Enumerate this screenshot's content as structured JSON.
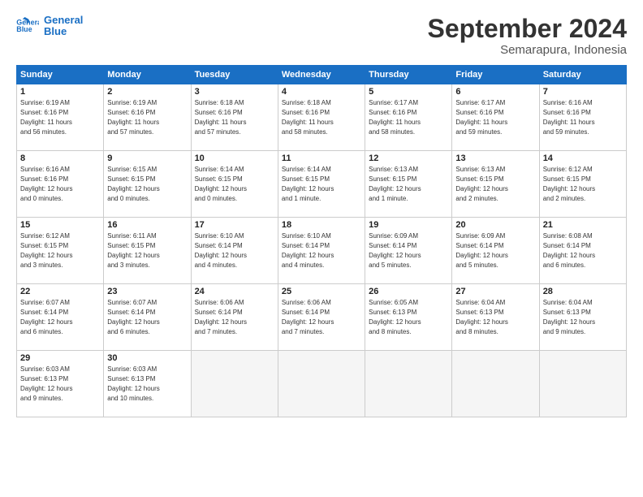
{
  "header": {
    "logo_text_general": "General",
    "logo_text_blue": "Blue",
    "month_title": "September 2024",
    "subtitle": "Semarapura, Indonesia"
  },
  "calendar": {
    "days_of_week": [
      "Sunday",
      "Monday",
      "Tuesday",
      "Wednesday",
      "Thursday",
      "Friday",
      "Saturday"
    ],
    "weeks": [
      [
        {
          "day": "",
          "info": ""
        },
        {
          "day": "2",
          "info": "Sunrise: 6:19 AM\nSunset: 6:16 PM\nDaylight: 11 hours\nand 57 minutes."
        },
        {
          "day": "3",
          "info": "Sunrise: 6:18 AM\nSunset: 6:16 PM\nDaylight: 11 hours\nand 57 minutes."
        },
        {
          "day": "4",
          "info": "Sunrise: 6:18 AM\nSunset: 6:16 PM\nDaylight: 11 hours\nand 58 minutes."
        },
        {
          "day": "5",
          "info": "Sunrise: 6:17 AM\nSunset: 6:16 PM\nDaylight: 11 hours\nand 58 minutes."
        },
        {
          "day": "6",
          "info": "Sunrise: 6:17 AM\nSunset: 6:16 PM\nDaylight: 11 hours\nand 59 minutes."
        },
        {
          "day": "7",
          "info": "Sunrise: 6:16 AM\nSunset: 6:16 PM\nDaylight: 11 hours\nand 59 minutes."
        }
      ],
      [
        {
          "day": "1",
          "info": "Sunrise: 6:19 AM\nSunset: 6:16 PM\nDaylight: 11 hours\nand 56 minutes."
        },
        {
          "day": "9",
          "info": "Sunrise: 6:15 AM\nSunset: 6:15 PM\nDaylight: 12 hours\nand 0 minutes."
        },
        {
          "day": "10",
          "info": "Sunrise: 6:14 AM\nSunset: 6:15 PM\nDaylight: 12 hours\nand 0 minutes."
        },
        {
          "day": "11",
          "info": "Sunrise: 6:14 AM\nSunset: 6:15 PM\nDaylight: 12 hours\nand 1 minute."
        },
        {
          "day": "12",
          "info": "Sunrise: 6:13 AM\nSunset: 6:15 PM\nDaylight: 12 hours\nand 1 minute."
        },
        {
          "day": "13",
          "info": "Sunrise: 6:13 AM\nSunset: 6:15 PM\nDaylight: 12 hours\nand 2 minutes."
        },
        {
          "day": "14",
          "info": "Sunrise: 6:12 AM\nSunset: 6:15 PM\nDaylight: 12 hours\nand 2 minutes."
        }
      ],
      [
        {
          "day": "8",
          "info": "Sunrise: 6:16 AM\nSunset: 6:16 PM\nDaylight: 12 hours\nand 0 minutes."
        },
        {
          "day": "16",
          "info": "Sunrise: 6:11 AM\nSunset: 6:15 PM\nDaylight: 12 hours\nand 3 minutes."
        },
        {
          "day": "17",
          "info": "Sunrise: 6:10 AM\nSunset: 6:14 PM\nDaylight: 12 hours\nand 4 minutes."
        },
        {
          "day": "18",
          "info": "Sunrise: 6:10 AM\nSunset: 6:14 PM\nDaylight: 12 hours\nand 4 minutes."
        },
        {
          "day": "19",
          "info": "Sunrise: 6:09 AM\nSunset: 6:14 PM\nDaylight: 12 hours\nand 5 minutes."
        },
        {
          "day": "20",
          "info": "Sunrise: 6:09 AM\nSunset: 6:14 PM\nDaylight: 12 hours\nand 5 minutes."
        },
        {
          "day": "21",
          "info": "Sunrise: 6:08 AM\nSunset: 6:14 PM\nDaylight: 12 hours\nand 6 minutes."
        }
      ],
      [
        {
          "day": "15",
          "info": "Sunrise: 6:12 AM\nSunset: 6:15 PM\nDaylight: 12 hours\nand 3 minutes."
        },
        {
          "day": "23",
          "info": "Sunrise: 6:07 AM\nSunset: 6:14 PM\nDaylight: 12 hours\nand 6 minutes."
        },
        {
          "day": "24",
          "info": "Sunrise: 6:06 AM\nSunset: 6:14 PM\nDaylight: 12 hours\nand 7 minutes."
        },
        {
          "day": "25",
          "info": "Sunrise: 6:06 AM\nSunset: 6:14 PM\nDaylight: 12 hours\nand 7 minutes."
        },
        {
          "day": "26",
          "info": "Sunrise: 6:05 AM\nSunset: 6:13 PM\nDaylight: 12 hours\nand 8 minutes."
        },
        {
          "day": "27",
          "info": "Sunrise: 6:04 AM\nSunset: 6:13 PM\nDaylight: 12 hours\nand 8 minutes."
        },
        {
          "day": "28",
          "info": "Sunrise: 6:04 AM\nSunset: 6:13 PM\nDaylight: 12 hours\nand 9 minutes."
        }
      ],
      [
        {
          "day": "22",
          "info": "Sunrise: 6:07 AM\nSunset: 6:14 PM\nDaylight: 12 hours\nand 6 minutes."
        },
        {
          "day": "30",
          "info": "Sunrise: 6:03 AM\nSunset: 6:13 PM\nDaylight: 12 hours\nand 10 minutes."
        },
        {
          "day": "",
          "info": ""
        },
        {
          "day": "",
          "info": ""
        },
        {
          "day": "",
          "info": ""
        },
        {
          "day": "",
          "info": ""
        },
        {
          "day": "",
          "info": ""
        }
      ],
      [
        {
          "day": "29",
          "info": "Sunrise: 6:03 AM\nSunset: 6:13 PM\nDaylight: 12 hours\nand 9 minutes."
        },
        {
          "day": "",
          "info": ""
        },
        {
          "day": "",
          "info": ""
        },
        {
          "day": "",
          "info": ""
        },
        {
          "day": "",
          "info": ""
        },
        {
          "day": "",
          "info": ""
        },
        {
          "day": "",
          "info": ""
        }
      ]
    ]
  }
}
